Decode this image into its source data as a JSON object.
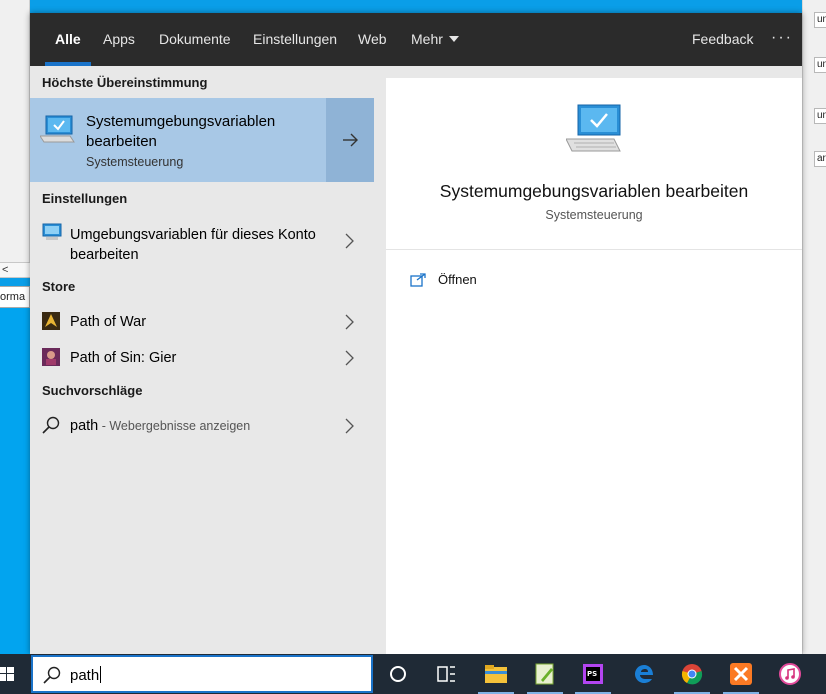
{
  "background": {
    "left_strip_text": "rma",
    "left_strip2_text": "orma",
    "right_chips": [
      "un",
      "un",
      "un",
      "ari"
    ]
  },
  "topbar": {
    "tabs": [
      {
        "label": "Alle",
        "active": true
      },
      {
        "label": "Apps"
      },
      {
        "label": "Dokumente"
      },
      {
        "label": "Einstellungen"
      },
      {
        "label": "Web"
      },
      {
        "label": "Mehr",
        "dropdown": true
      }
    ],
    "feedback_label": "Feedback",
    "more_options": "···"
  },
  "results": {
    "best_match_heading": "Höchste Übereinstimmung",
    "best_match": {
      "title": "Systemumgebungsvariablen bearbeiten",
      "subtitle": "Systemsteuerung",
      "icon": "computer-monitor-icon"
    },
    "settings_heading": "Einstellungen",
    "settings_items": [
      {
        "label": "Umgebungsvariablen für dieses Konto bearbeiten",
        "icon": "monitor-settings-icon"
      }
    ],
    "store_heading": "Store",
    "store_items": [
      {
        "label": "Path of War",
        "icon": "path-of-war-icon"
      },
      {
        "label": "Path of Sin: Gier",
        "icon": "path-of-sin-icon"
      }
    ],
    "suggestions_heading": "Suchvorschläge",
    "suggestions": [
      {
        "label": "path",
        "hint": " - Webergebnisse anzeigen",
        "icon": "search-icon"
      }
    ]
  },
  "preview": {
    "title": "Systemumgebungsvariablen bearbeiten",
    "subtitle": "Systemsteuerung",
    "actions": [
      {
        "label": "Öffnen",
        "icon": "open-external-icon"
      }
    ]
  },
  "taskbar": {
    "search_query": "path",
    "apps": [
      "cortana-icon",
      "task-view-icon",
      "file-explorer-icon",
      "notepad-plus-icon",
      "phpstorm-icon",
      "edge-icon",
      "chrome-icon",
      "xampp-icon",
      "itunes-icon"
    ]
  },
  "colors": {
    "accent": "#1a73c9",
    "topbar": "#2b2b2b",
    "selected": "#a8c8e6",
    "desktop": "#02a4ef"
  }
}
